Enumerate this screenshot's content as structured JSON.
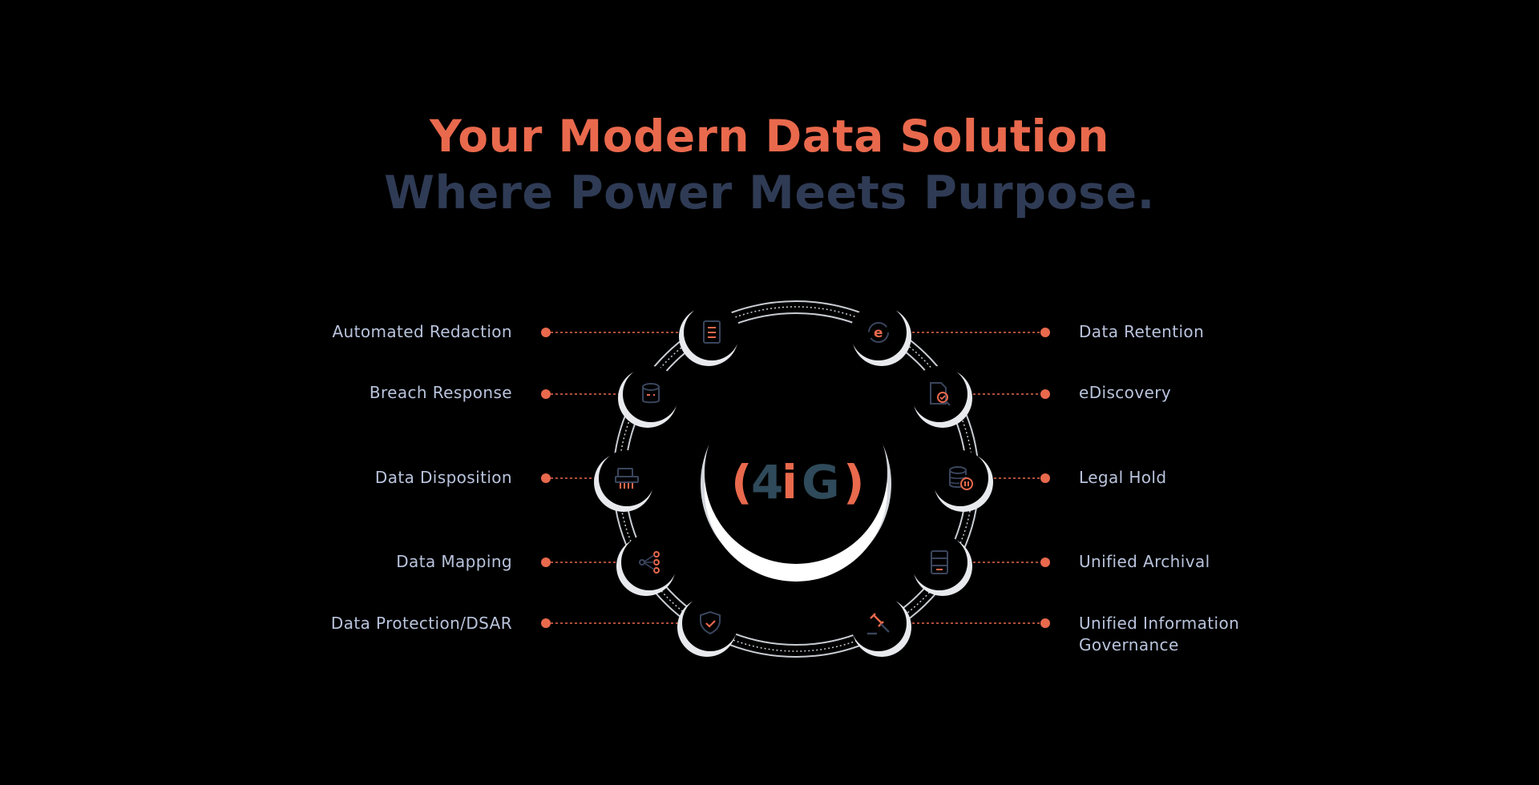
{
  "header": {
    "title_line1": "Your Modern Data Solution",
    "title_line2": "Where Power Meets Purpose."
  },
  "logo": {
    "paren_open": "(",
    "digit": "4",
    "i": "i",
    "g": "G",
    "paren_close": ")"
  },
  "left_items": [
    {
      "label": "Automated Redaction",
      "icon": "document-icon"
    },
    {
      "label": "Breach Response",
      "icon": "database-icon"
    },
    {
      "label": "Data Disposition",
      "icon": "shredder-icon"
    },
    {
      "label": "Data Mapping",
      "icon": "network-icon"
    },
    {
      "label": "Data Protection/DSAR",
      "icon": "shield-check-icon"
    }
  ],
  "right_items": [
    {
      "label": "Data Retention",
      "icon": "e-cycle-icon"
    },
    {
      "label": "eDiscovery",
      "icon": "file-search-icon"
    },
    {
      "label": "Legal Hold",
      "icon": "database-pause-icon"
    },
    {
      "label": "Unified Archival",
      "icon": "archive-icon"
    },
    {
      "label": "Unified Information Governance",
      "icon": "gavel-icon"
    }
  ],
  "colors": {
    "accent": "#e9694d",
    "navy": "#2f3b55",
    "label": "#b9c3dc",
    "ring": "#c8ccd2",
    "icon_stroke": "#3a455c",
    "background": "#000000"
  }
}
